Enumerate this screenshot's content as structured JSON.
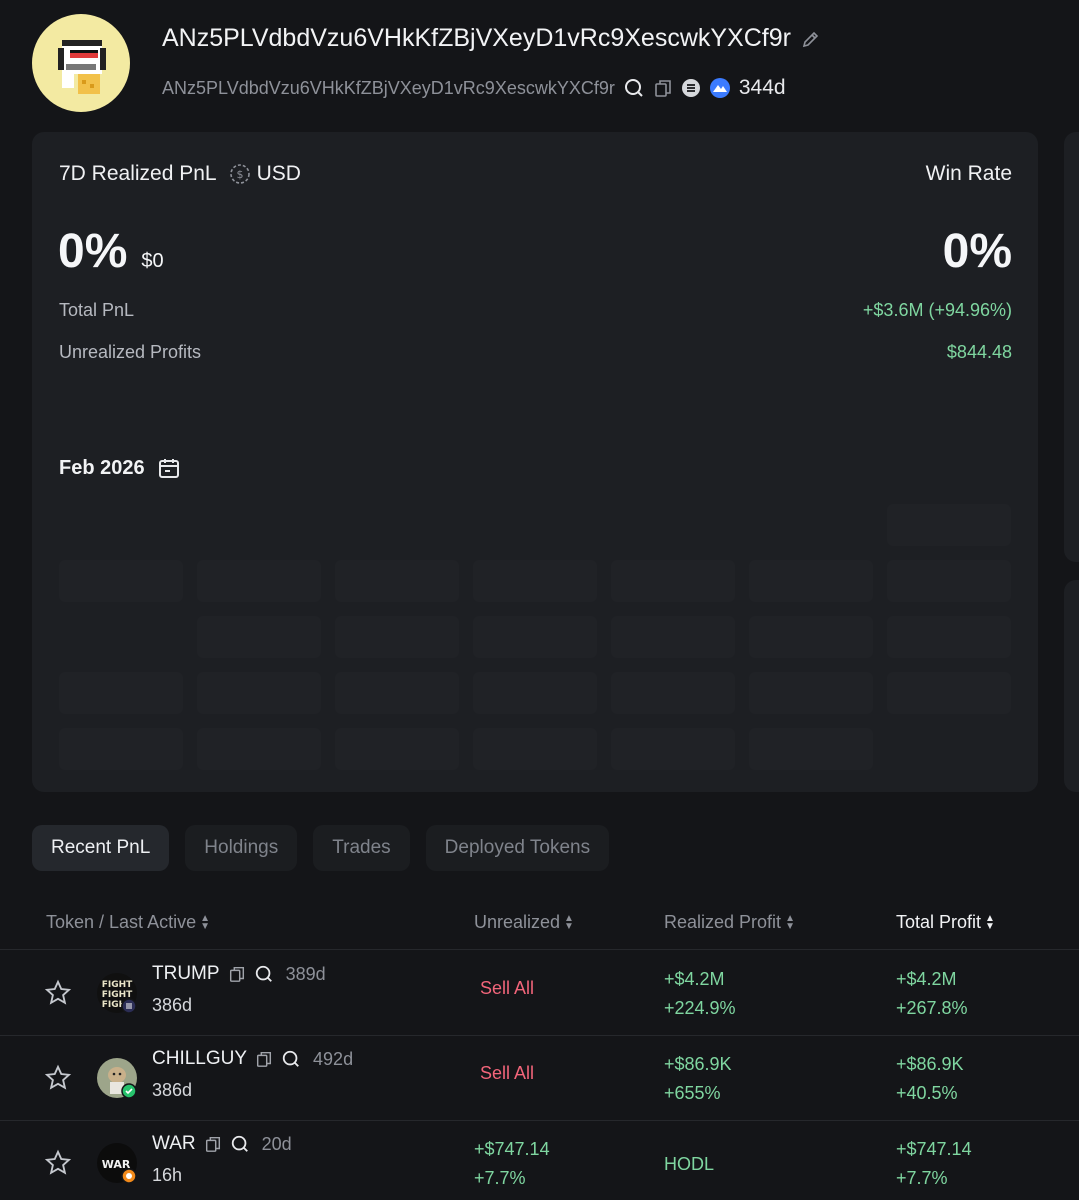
{
  "wallet": {
    "title": "ANz5PLVdbdVzu6VHkKfZBjVXeyD1vRc9XescwkYXCf9r",
    "address": "ANz5PLVdbdVzu6VHkKfZBjVXeyD1vRc9XescwkYXCf9r",
    "age": "344d"
  },
  "summary": {
    "pnl_label": "7D Realized PnL",
    "currency": "USD",
    "pnl_pct": "0%",
    "pnl_amount": "$0",
    "winrate_label": "Win Rate",
    "winrate_value": "0%",
    "total_pnl_label": "Total PnL",
    "total_pnl_value": "+$3.6M (+94.96%)",
    "unrealized_label": "Unrealized Profits",
    "unrealized_value": "$844.48",
    "month": "Feb 2026"
  },
  "tabs": [
    "Recent PnL",
    "Holdings",
    "Trades",
    "Deployed Tokens"
  ],
  "table": {
    "headers": {
      "token": "Token / Last Active",
      "unrealized": "Unrealized",
      "realized": "Realized Profit",
      "total": "Total Profit"
    },
    "rows": [
      {
        "name": "TRUMP",
        "age": "389d",
        "last_active": "386d",
        "unrealized": "Sell All",
        "realized_amount": "+$4.2M",
        "realized_pct": "+224.9%",
        "total_amount": "+$4.2M",
        "total_pct": "+267.8%"
      },
      {
        "name": "CHILLGUY",
        "age": "492d",
        "last_active": "386d",
        "unrealized": "Sell All",
        "realized_amount": "+$86.9K",
        "realized_pct": "+655%",
        "total_amount": "+$86.9K",
        "total_pct": "+40.5%"
      },
      {
        "name": "WAR",
        "age": "20d",
        "last_active": "16h",
        "unrealized_amount": "+$747.14",
        "unrealized_pct": "+7.7%",
        "realized": "HODL",
        "total_amount": "+$747.14",
        "total_pct": "+7.7%"
      }
    ]
  },
  "colors": {
    "background": "#141518",
    "card": "#1d1f23",
    "positive": "#7fd6a0",
    "negative": "#f2657a"
  }
}
